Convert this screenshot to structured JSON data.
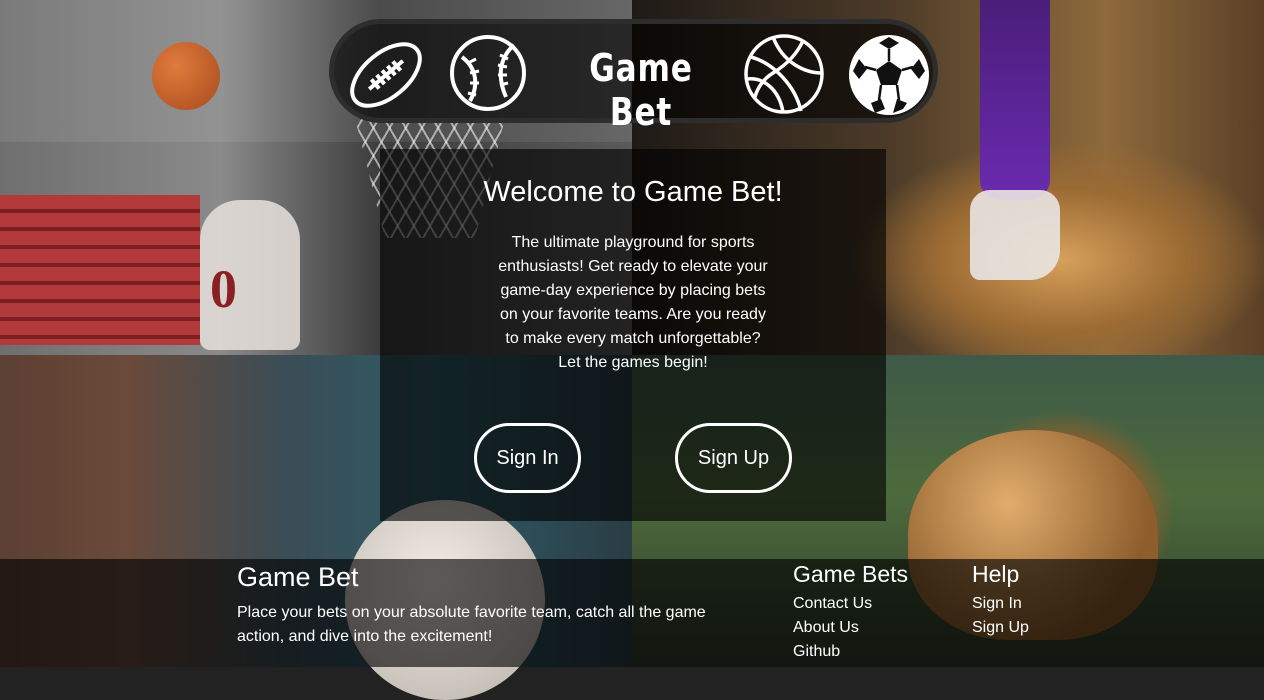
{
  "header": {
    "title": "Game Bet",
    "icons": [
      "football-icon",
      "baseball-icon",
      "basketball-icon",
      "soccer-ball-icon"
    ]
  },
  "welcome": {
    "title": "Welcome to Game Bet!",
    "text": "The ultimate playground for sports enthusiasts! Get ready to elevate your game-day experience by placing bets on your favorite teams. Are you ready to make every match unforgettable? Let the games begin!",
    "sign_in_label": "Sign In",
    "sign_up_label": "Sign Up"
  },
  "footer": {
    "brand": "Game Bet",
    "description": "Place your bets on your absolute favorite team, catch all the game action, and dive into the excitement!",
    "columns": [
      {
        "heading": "Game Bets",
        "links": [
          "Contact Us",
          "About Us",
          "Github"
        ]
      },
      {
        "heading": "Help",
        "links": [
          "Sign In",
          "Sign Up"
        ]
      }
    ]
  },
  "colors": {
    "overlay": "#000000",
    "text": "#ffffff",
    "logo_border": "#2d2d2d"
  },
  "background_photo": {
    "jersey_number": "0"
  }
}
